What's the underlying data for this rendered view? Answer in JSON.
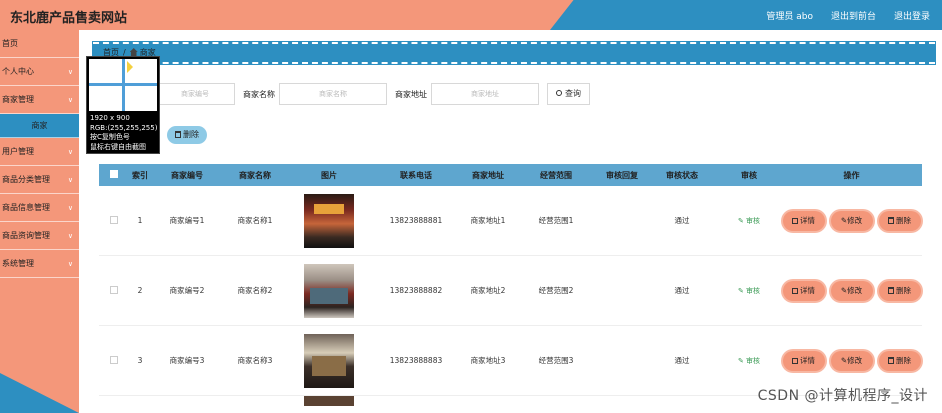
{
  "header": {
    "title": "东北鹿产品售卖网站",
    "admin_label": "管理员 abo",
    "front_link": "退出到前台",
    "logout_link": "退出登录"
  },
  "sidebar": {
    "items": [
      {
        "label": "首页",
        "chevron": false
      },
      {
        "label": "个人中心",
        "chevron": true
      },
      {
        "label": "商家管理",
        "chevron": true
      },
      {
        "label": "商家",
        "chevron": false,
        "active": true
      },
      {
        "label": "用户管理",
        "chevron": true
      },
      {
        "label": "商品分类管理",
        "chevron": true
      },
      {
        "label": "商品信息管理",
        "chevron": true
      },
      {
        "label": "商品资询管理",
        "chevron": true
      },
      {
        "label": "系统管理",
        "chevron": true
      }
    ]
  },
  "breadcrumb": {
    "home": "首页",
    "current": "商家"
  },
  "search": {
    "no_placeholder": "商家编号",
    "name_label": "商家名称",
    "name_placeholder": "商家名称",
    "addr_label": "商家地址",
    "addr_placeholder": "商家地址",
    "button": "查询"
  },
  "delete_button": "删除",
  "table": {
    "headers": [
      "索引",
      "商家编号",
      "商家名称",
      "图片",
      "联系电话",
      "商家地址",
      "经营范围",
      "审核回复",
      "审核状态",
      "审核",
      "操作"
    ],
    "rows": [
      {
        "idx": "1",
        "no": "商家编号1",
        "name": "商家名称1",
        "tel": "13823888881",
        "addr": "商家地址1",
        "scope": "经营范围1",
        "reply": "",
        "status": "通过",
        "audit": "审核"
      },
      {
        "idx": "2",
        "no": "商家编号2",
        "name": "商家名称2",
        "tel": "13823888882",
        "addr": "商家地址2",
        "scope": "经营范围2",
        "reply": "",
        "status": "通过",
        "audit": "审核"
      },
      {
        "idx": "3",
        "no": "商家编号3",
        "name": "商家名称3",
        "tel": "13823888883",
        "addr": "商家地址3",
        "scope": "经营范围3",
        "reply": "",
        "status": "通过",
        "audit": "审核"
      }
    ],
    "actions": {
      "detail": "详情",
      "edit": "修改",
      "delete": "删除"
    }
  },
  "snip_tool": {
    "size": "1920 x 900",
    "rgb": "RGB:(255,255,255)",
    "hint1": "按C复制色号",
    "hint2": "鼠标右键自由截图"
  },
  "watermark": "CSDN @计算机程序_设计",
  "colors": {
    "accent_orange": "#f4977a",
    "accent_blue": "#2d8fc1",
    "header_row": "#5ea6cf"
  }
}
